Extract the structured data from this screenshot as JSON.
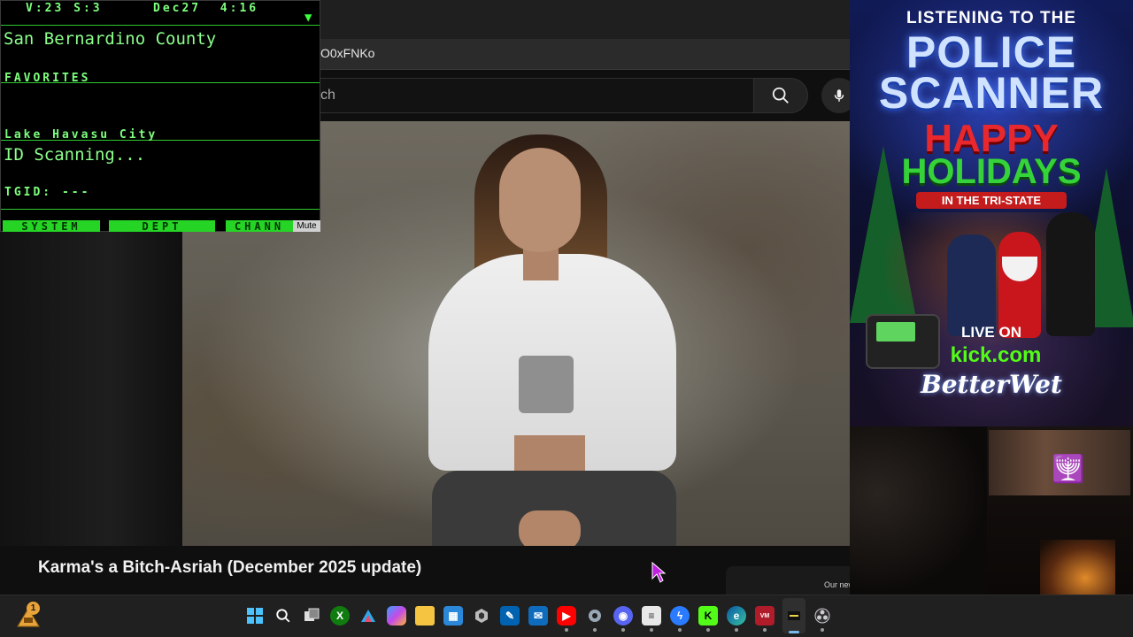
{
  "browser": {
    "url_fragment": "O0xFNKo",
    "search_placeholder": "ch"
  },
  "video": {
    "title": "Karma's a Bitch-Asriah (December 2025 update)",
    "card_text": "Our new"
  },
  "scanner": {
    "status": "V:23  S:3",
    "date": "Dec27",
    "time": "4:16",
    "system": "San Bernardino County",
    "favorites_label": "FAVORITES",
    "department": "Lake Havasu City",
    "id_status": "ID Scanning...",
    "tgid": "TGID: ---",
    "btn_system": "SYSTEM",
    "btn_dept": "DEPT",
    "btn_channel": "CHANN",
    "mute": "Mute"
  },
  "poster": {
    "line1": "LISTENING TO THE",
    "line2": "POLICE",
    "line3": "SCANNER",
    "line4": "HAPPY",
    "line5": "HOLIDAYS",
    "banner": "IN THE TRI-STATE",
    "live": "LIVE ON",
    "kick": "kick.com",
    "brand": "BetterWet"
  },
  "taskbar": {
    "notification_count": "1",
    "icons": [
      "windows-start",
      "search",
      "task-view",
      "xbox",
      "app-triangle",
      "copilot",
      "file-explorer",
      "microsoft-store",
      "terminal",
      "snipping-tool",
      "mail",
      "youtube",
      "settings",
      "discord",
      "notepad",
      "messenger",
      "kick",
      "edge",
      "voicemeeter",
      "active-app",
      "obs"
    ]
  },
  "colors": {
    "scanner_green": "#7dff7d",
    "kick_green": "#53fc18",
    "holiday_red": "#e8282c"
  }
}
